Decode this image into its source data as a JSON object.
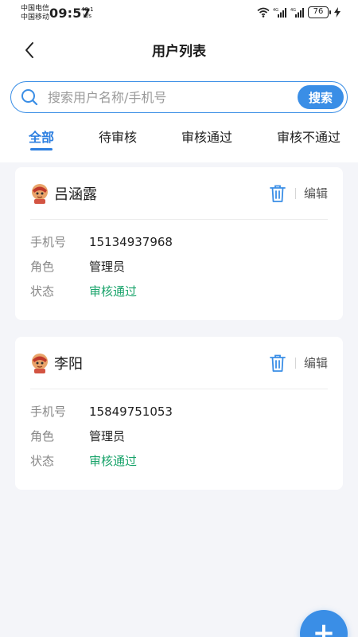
{
  "status_bar": {
    "carrier_1": "中国电信",
    "carrier_2": "中国移动",
    "time": "09:57",
    "net_speed_value": "40.1",
    "net_speed_unit": "K/s",
    "battery": "76"
  },
  "nav": {
    "title": "用户列表"
  },
  "search": {
    "placeholder": "搜索用户名称/手机号",
    "button_label": "搜索"
  },
  "tabs": [
    {
      "label": "全部",
      "active": true
    },
    {
      "label": "待审核",
      "active": false
    },
    {
      "label": "审核通过",
      "active": false
    },
    {
      "label": "审核不通过",
      "active": false
    }
  ],
  "labels": {
    "phone": "手机号",
    "role": "角色",
    "status": "状态",
    "edit": "编辑"
  },
  "users": [
    {
      "name": "吕涵露",
      "phone": "15134937968",
      "role": "管理员",
      "status": "审核通过"
    },
    {
      "name": "李阳",
      "phone": "15849751053",
      "role": "管理员",
      "status": "审核通过"
    }
  ],
  "fab": {
    "icon": "plus-icon"
  },
  "colors": {
    "accent": "#3a8ee6",
    "status_approved": "#1aa46b",
    "background": "#f4f5f9"
  }
}
